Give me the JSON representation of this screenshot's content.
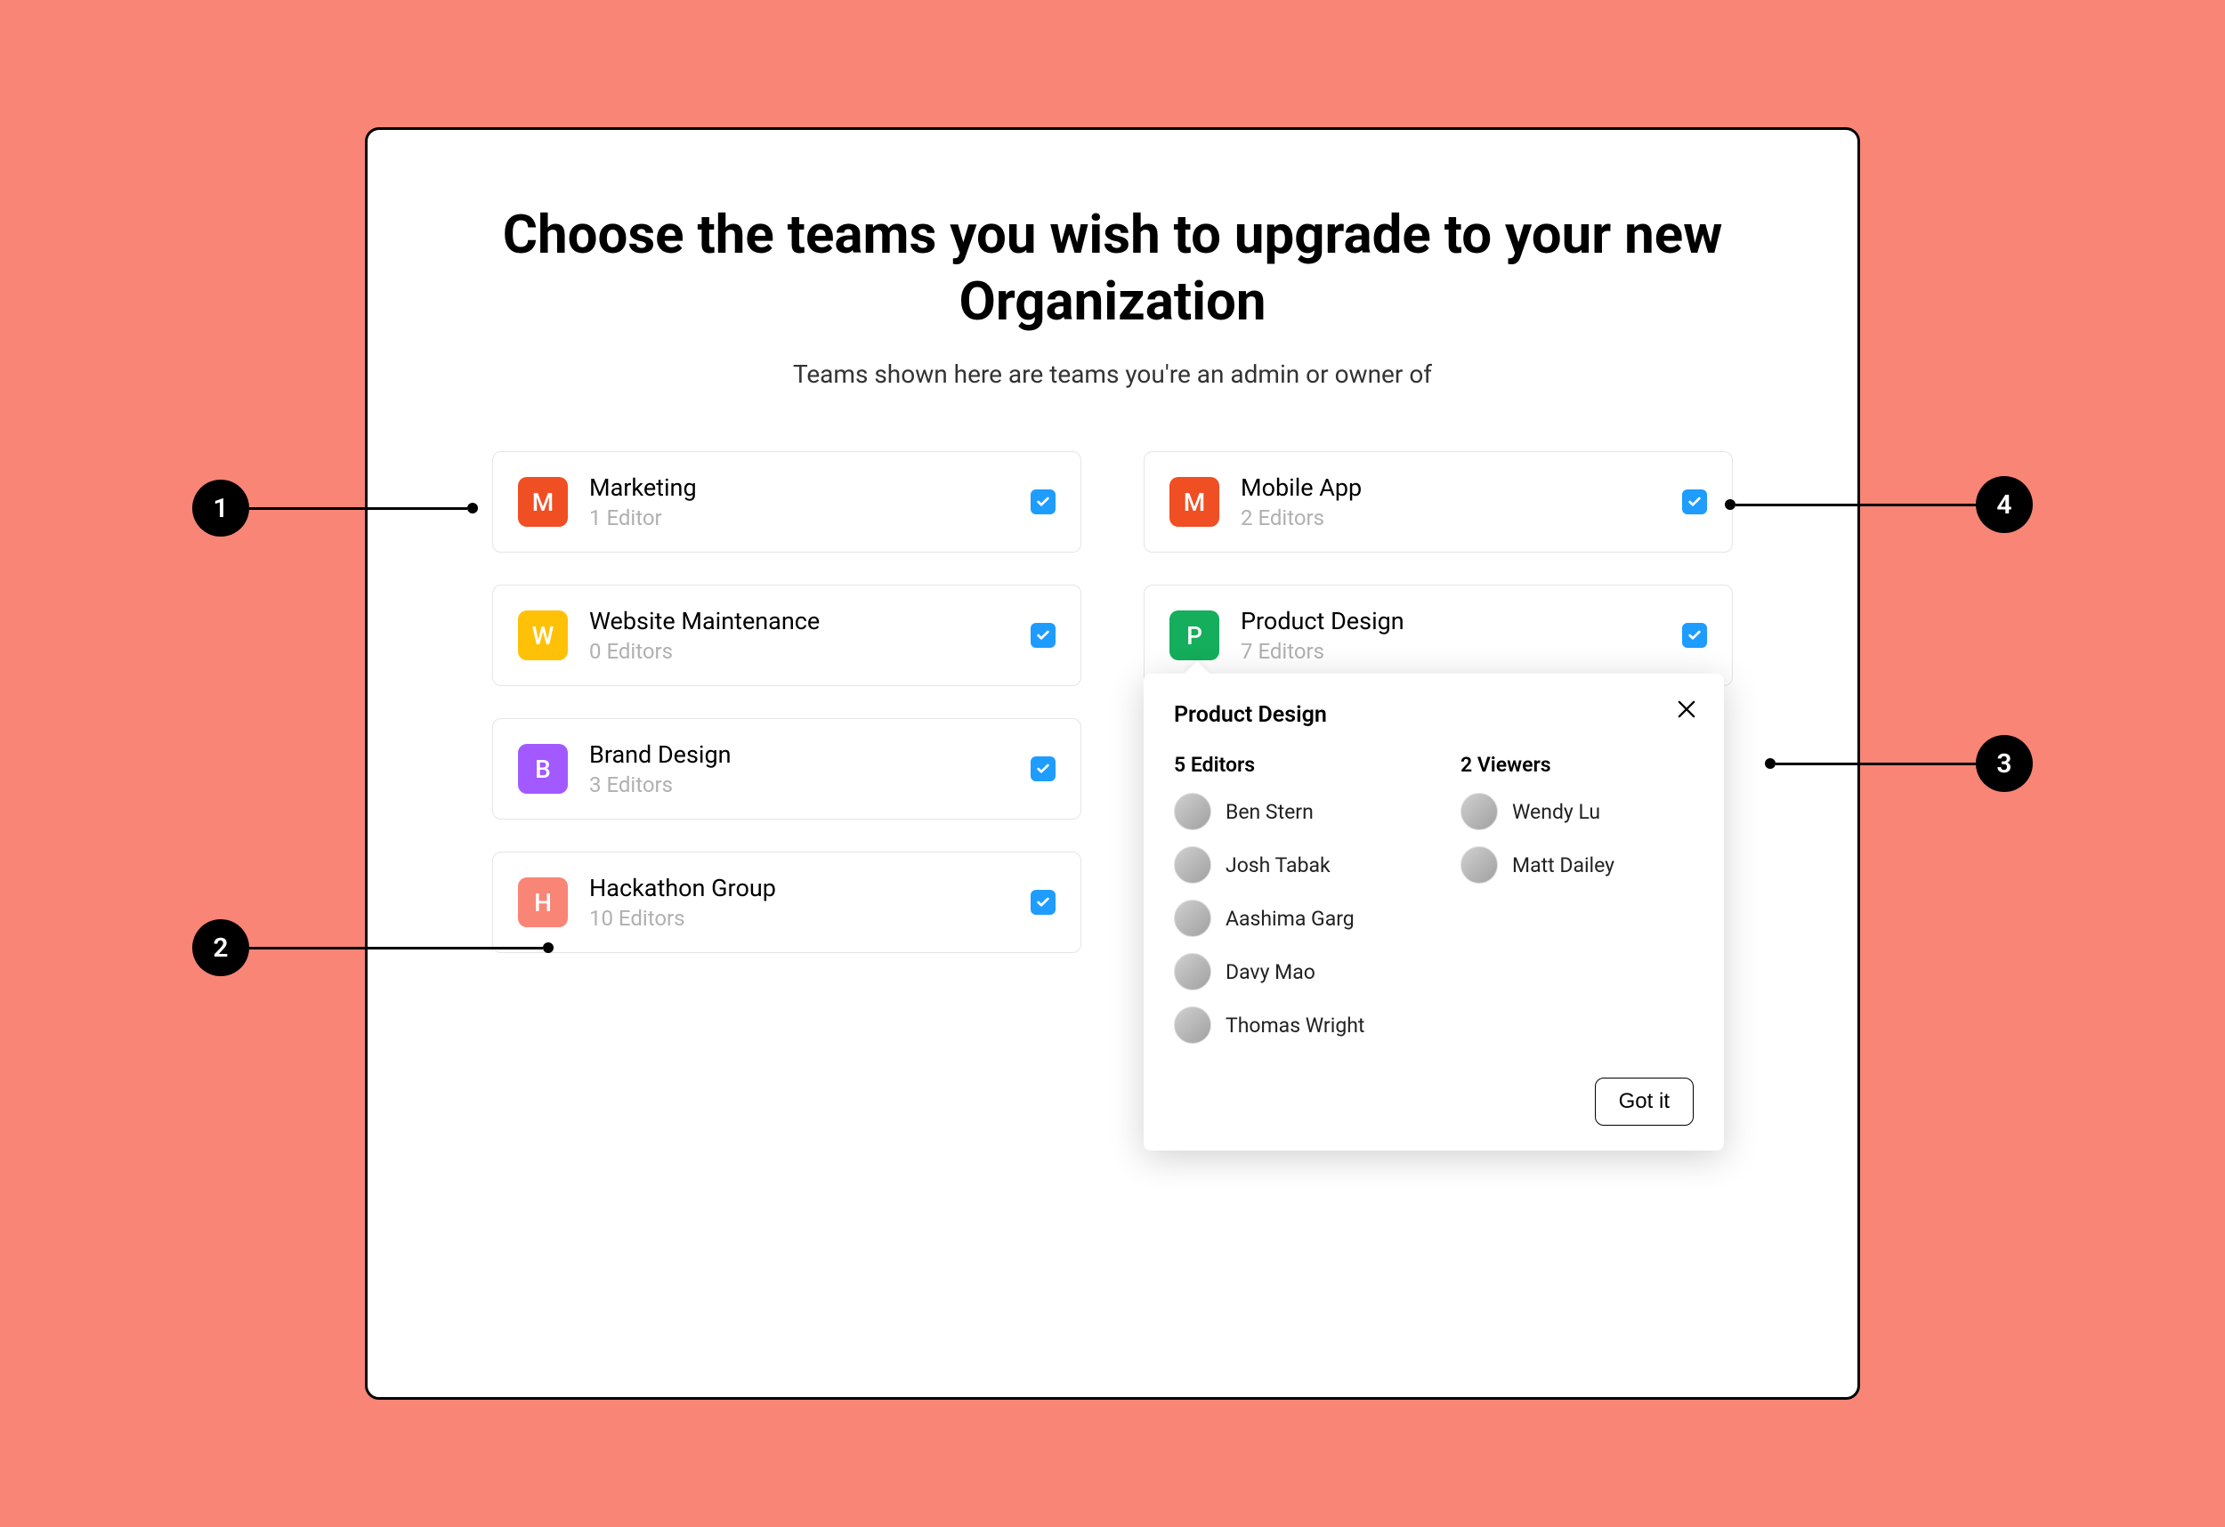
{
  "heading": "Choose the teams you wish to upgrade to your new Organization",
  "subheading": "Teams shown here are teams you're an admin or owner of",
  "teams": [
    {
      "initial": "M",
      "name": "Marketing",
      "sub": "1 Editor",
      "color": "#f04e23"
    },
    {
      "initial": "M",
      "name": "Mobile App",
      "sub": "2 Editors",
      "color": "#f04e23"
    },
    {
      "initial": "W",
      "name": "Website Maintenance",
      "sub": "0 Editors",
      "color": "#ffc107"
    },
    {
      "initial": "P",
      "name": "Product Design",
      "sub": "7 Editors",
      "color": "#14ae5c"
    },
    {
      "initial": "B",
      "name": "Brand Design",
      "sub": "3 Editors",
      "color": "#a259ff"
    },
    {
      "initial": "H",
      "name": "Hackathon Group",
      "sub": "10 Editors",
      "color": "#f88576"
    }
  ],
  "popover": {
    "title": "Product Design",
    "editors_head": "5 Editors",
    "viewers_head": "2 Viewers",
    "editors": [
      {
        "name": "Ben Stern"
      },
      {
        "name": "Josh Tabak"
      },
      {
        "name": "Aashima Garg"
      },
      {
        "name": "Davy Mao"
      },
      {
        "name": "Thomas Wright"
      }
    ],
    "viewers": [
      {
        "name": "Wendy Lu"
      },
      {
        "name": "Matt Dailey"
      }
    ],
    "confirm": "Got it"
  },
  "callouts": {
    "c1": "1",
    "c2": "2",
    "c3": "3",
    "c4": "4"
  }
}
